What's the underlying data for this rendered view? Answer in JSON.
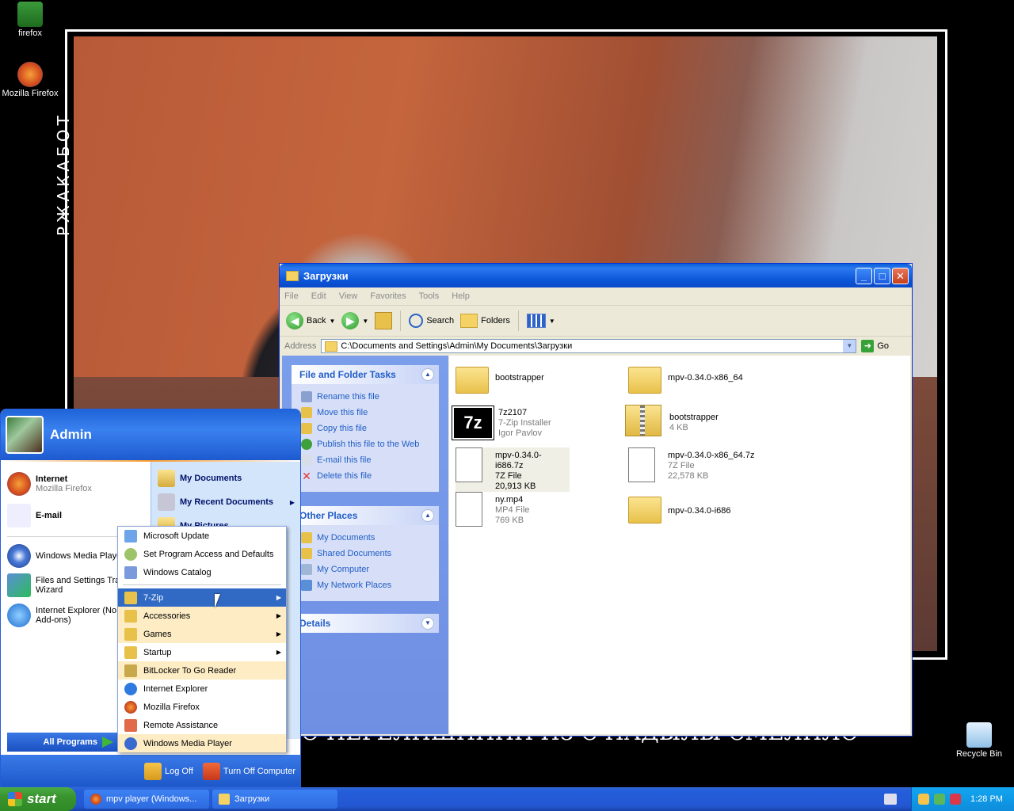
{
  "desktop": {
    "icons": [
      {
        "label": "firefox"
      },
      {
        "label": "Mozilla Firefox"
      },
      {
        "label": "Recycle Bin"
      }
    ],
    "vertical_text": "РЖАКАБОТ",
    "caption_strip": "О ПЕРЕЛИШИНИН ИЗ С НАДЫЛЫ СМЕЛИЛО"
  },
  "explorer": {
    "title": "Загрузки",
    "menu": [
      "File",
      "Edit",
      "View",
      "Favorites",
      "Tools",
      "Help"
    ],
    "toolbar": {
      "back": "Back",
      "search": "Search",
      "folders": "Folders"
    },
    "address_label": "Address",
    "address_value": "C:\\Documents and Settings\\Admin\\My Documents\\Загрузки",
    "go_label": "Go",
    "file_tasks": {
      "title": "File and Folder Tasks",
      "items": [
        "Rename this file",
        "Move this file",
        "Copy this file",
        "Publish this file to the Web",
        "E-mail this file",
        "Delete this file"
      ]
    },
    "other_places": {
      "title": "Other Places",
      "items": [
        "My Documents",
        "Shared Documents",
        "My Computer",
        "My Network Places"
      ]
    },
    "details": {
      "title": "Details"
    },
    "files": [
      {
        "name": "bootstrapper",
        "type": "",
        "size": "",
        "icon": "folder-icon"
      },
      {
        "name": "mpv-0.34.0-x86_64",
        "type": "",
        "size": "",
        "icon": "folder-icon"
      },
      {
        "name": "7z2107",
        "type": "7-Zip Installer",
        "size": "Igor Pavlov",
        "icon": "7zip-installer-icon"
      },
      {
        "name": "bootstrapper",
        "type": "4 KB",
        "size": "",
        "icon": "zip-folder-icon"
      },
      {
        "name": "mpv-0.34.0-i686.7z",
        "type": "7Z File",
        "size": "20,913 KB",
        "icon": "7z-file-icon"
      },
      {
        "name": "mpv-0.34.0-x86_64.7z",
        "type": "7Z File",
        "size": "22,578 KB",
        "icon": "7z-file-icon"
      },
      {
        "name": "ny.mp4",
        "type": "MP4 File",
        "size": "769 KB",
        "icon": "mp4-file-icon"
      },
      {
        "name": "mpv-0.34.0-i686",
        "type": "",
        "size": "",
        "icon": "folder-icon"
      }
    ]
  },
  "startmenu": {
    "user": "Admin",
    "pinned": [
      {
        "title": "Internet",
        "sub": "Mozilla Firefox"
      },
      {
        "title": "E-mail",
        "sub": ""
      }
    ],
    "recent": [
      {
        "title": "Windows Media Playe"
      },
      {
        "title": "Files and Settings Tra",
        "line2": "Wizard"
      },
      {
        "title": "Internet Explorer (No",
        "line2": "Add-ons)"
      }
    ],
    "right": [
      "My Documents",
      "My Recent Documents",
      "My Pictures"
    ],
    "all_programs": "All Programs",
    "log_off": "Log Off",
    "turn_off": "Turn Off Computer"
  },
  "programs_menu": {
    "top": [
      "Microsoft Update",
      "Set Program Access and Defaults",
      "Windows Catalog"
    ],
    "items": [
      {
        "label": "7-Zip",
        "submenu": true
      },
      {
        "label": "Accessories",
        "submenu": true
      },
      {
        "label": "Games",
        "submenu": true
      },
      {
        "label": "Startup",
        "submenu": true
      },
      {
        "label": "BitLocker To Go Reader",
        "submenu": false
      },
      {
        "label": "Internet Explorer",
        "submenu": false
      },
      {
        "label": "Mozilla Firefox",
        "submenu": false
      },
      {
        "label": "Remote Assistance",
        "submenu": false
      },
      {
        "label": "Windows Media Player",
        "submenu": false
      }
    ]
  },
  "taskbar": {
    "start": "start",
    "tasks": [
      "mpv player (Windows...",
      "Загрузки"
    ],
    "clock": "1:28 PM"
  }
}
